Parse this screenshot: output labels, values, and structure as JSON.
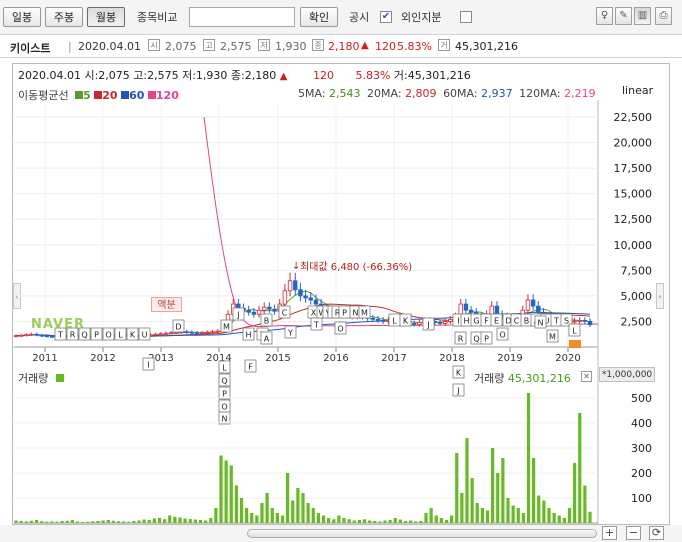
{
  "toolbar": {
    "period_buttons": [
      "일봉",
      "주봉",
      "월봉"
    ],
    "active_period": "월봉",
    "compare_label": "종목비교",
    "compare_placeholder": "",
    "confirm_button": "확인",
    "disclosure_label": "공시",
    "disclosure_checked": true,
    "foreign_label": "외인지분",
    "foreign_checked": false,
    "icons": [
      "bulb-icon",
      "pen-icon",
      "chart-toggle-icon",
      "print-icon"
    ]
  },
  "stock_info": {
    "name": "키이스트",
    "date": "2020.04.01",
    "open_label": "시",
    "open": "2,075",
    "high_label": "고",
    "high": "2,575",
    "low_label": "저",
    "low": "1,930",
    "close_label": "종",
    "close": "2,180",
    "change_arrow": "▲",
    "change": "120",
    "change_pct": "5.83%",
    "volume_label": "거",
    "volume": "45,301,216"
  },
  "chart_header": {
    "text": "2020.04.01 시:2,075 고:2,575 저:1,930 종:2,180",
    "arrow": "▲",
    "change": "120",
    "change_pct": "5.83%",
    "volume_text": "거:45,301,216"
  },
  "ma_legend": {
    "title": "이동평균선",
    "items": [
      {
        "label": "5",
        "color": "#5c9c2c"
      },
      {
        "label": "20",
        "color": "#c8282d"
      },
      {
        "label": "60",
        "color": "#2253b8"
      },
      {
        "label": "120",
        "color": "#e8418f"
      }
    ]
  },
  "ma_values": [
    {
      "label": "5MA:",
      "value": "2,543",
      "color": "#4a8a1e"
    },
    {
      "label": "20MA:",
      "value": "2,809",
      "color": "#c8282d"
    },
    {
      "label": "60MA:",
      "value": "2,937",
      "color": "#2253b8"
    },
    {
      "label": "120MA:",
      "value": "2,219",
      "color": "#e8418f"
    }
  ],
  "scale_label": "linear",
  "price_ticks": [
    "22,500",
    "20,000",
    "17,500",
    "15,000",
    "12,500",
    "10,000",
    "7,500",
    "5,000",
    "2,500"
  ],
  "year_labels": [
    "2011",
    "2012",
    "2013",
    "2014",
    "2015",
    "2016",
    "2017",
    "2018",
    "2019",
    "2020"
  ],
  "max_annotation": "최대값 6,480 (-66.36%)",
  "dividend_label": "액분",
  "watermark": "NAVER",
  "volume_panel": {
    "label": "거래량",
    "right_label": "거래량",
    "right_value": "45,301,216",
    "unit": "*1,000,000",
    "ticks": [
      "500",
      "400",
      "300",
      "200",
      "100"
    ]
  },
  "event_markers": [
    "T",
    "R",
    "Q",
    "P",
    "O",
    "L",
    "K",
    "U",
    "D",
    "I",
    "M",
    "L",
    "J",
    "H",
    "T",
    "B",
    "A",
    "C",
    "Y",
    "Q",
    "P",
    "O",
    "N",
    "F",
    "X",
    "W",
    "V",
    "T",
    "S",
    "R",
    "P",
    "O",
    "N",
    "M",
    "L",
    "K",
    "J",
    "I",
    "H",
    "G",
    "F",
    "E",
    "D",
    "C",
    "B",
    "A",
    "U",
    "T",
    "S",
    "R",
    "Q",
    "P",
    "O",
    "N",
    "M",
    "L",
    "K",
    "J",
    "I",
    "H",
    "G",
    "F",
    "E",
    "D",
    "C",
    "B",
    "A"
  ],
  "chart_data": {
    "type": "candlestick",
    "title": "",
    "x_labels": [
      "2011",
      "2012",
      "2013",
      "2014",
      "2015",
      "2016",
      "2017",
      "2018",
      "2019",
      "2020"
    ],
    "y_axis": {
      "scale": "linear",
      "ticks": [
        2500,
        5000,
        7500,
        10000,
        12500,
        15000,
        17500,
        20000,
        22500
      ]
    },
    "last_bar": {
      "date": "2020.04.01",
      "open": 2075,
      "high": 2575,
      "low": 1930,
      "close": 2180,
      "volume": 45301216
    },
    "max_value": {
      "value": 6480,
      "pct_from_current": "-66.36%"
    },
    "ma": {
      "5": 2543,
      "20": 2809,
      "60": 2937,
      "120": 2219
    },
    "close_approx": [
      1100,
      1150,
      1200,
      1250,
      1150,
      1100,
      1050,
      1000,
      950,
      1000,
      1050,
      1100,
      1000,
      950,
      900,
      950,
      1000,
      1050,
      1100,
      1150,
      1200,
      1150,
      1100,
      1050,
      1100,
      1150,
      1200,
      1250,
      1300,
      1350,
      1400,
      1450,
      1500,
      1450,
      1400,
      1350,
      1400,
      1450,
      1500,
      1550,
      2200,
      3200,
      4200,
      3800,
      3600,
      3400,
      3200,
      3600,
      3900,
      3700,
      3500,
      4200,
      5500,
      6480,
      5600,
      5000,
      4800,
      4600,
      4200,
      3800,
      3500,
      3400,
      3600,
      3300,
      3100,
      3000,
      3200,
      3000,
      2800,
      2700,
      2600,
      2500,
      2600,
      2700,
      2500,
      2400,
      2300,
      2200,
      2400,
      2600,
      2500,
      2400,
      2300,
      2500,
      2700,
      3000,
      4200,
      3600,
      3400,
      3000,
      2800,
      3200,
      4000,
      3200,
      3000,
      2900,
      2700,
      2600,
      3600,
      4600,
      4000,
      3400,
      3000,
      2900,
      2800,
      2700,
      2600,
      2500,
      2543,
      2600,
      2500,
      2180
    ],
    "volume_series_name": "거래량",
    "volume_unit": "*1,000,000",
    "volume_ticks": [
      100,
      200,
      300,
      400,
      500
    ],
    "volume_approx": [
      10,
      8,
      6,
      9,
      12,
      7,
      5,
      6,
      5,
      8,
      9,
      12,
      6,
      4,
      5,
      7,
      8,
      10,
      12,
      9,
      7,
      6,
      5,
      8,
      10,
      14,
      12,
      18,
      20,
      15,
      30,
      25,
      22,
      18,
      16,
      14,
      12,
      10,
      20,
      60,
      270,
      250,
      230,
      150,
      100,
      60,
      40,
      30,
      80,
      120,
      60,
      40,
      30,
      200,
      90,
      140,
      120,
      80,
      60,
      40,
      30,
      20,
      15,
      30,
      20,
      15,
      10,
      12,
      15,
      10,
      8,
      6,
      10,
      12,
      20,
      14,
      8,
      10,
      6,
      8,
      40,
      60,
      30,
      20,
      12,
      30,
      280,
      120,
      340,
      180,
      80,
      60,
      50,
      300,
      200,
      260,
      100,
      70,
      60,
      40,
      520,
      260,
      110,
      90,
      60,
      40,
      30,
      20,
      60,
      240,
      440,
      150,
      45
    ]
  }
}
